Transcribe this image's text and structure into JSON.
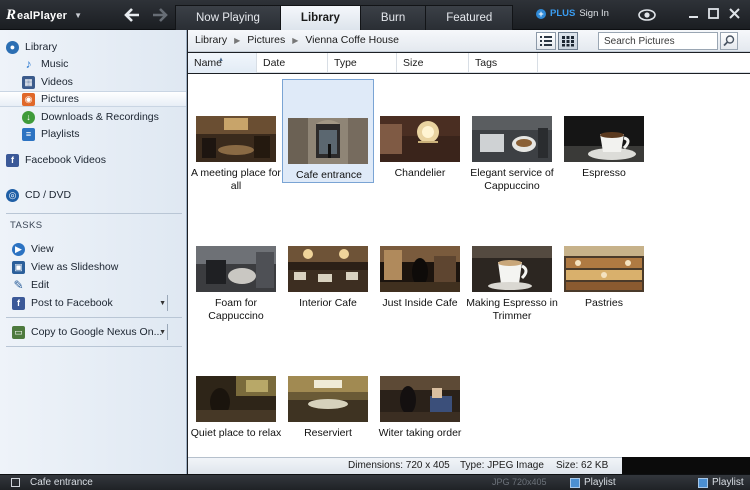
{
  "app": {
    "logo_mark": "R",
    "logo_text": "ealPlayer",
    "tabs": [
      {
        "label": "Now Playing",
        "active": false
      },
      {
        "label": "Library",
        "active": true
      },
      {
        "label": "Burn",
        "active": false
      },
      {
        "label": "Featured",
        "active": false
      }
    ],
    "plus_label": "PLUS",
    "signin_label": "Sign In",
    "icons": {
      "back": "arrow-left-icon",
      "forward": "arrow-right-icon",
      "eye": "eye-icon",
      "minimize": "minimize-icon",
      "maximize": "maximize-icon",
      "close": "close-icon"
    }
  },
  "sidebar": {
    "items": [
      {
        "label": "Library",
        "icon": "library-icon",
        "selected": false
      },
      {
        "label": "Music",
        "icon": "music-note-icon",
        "selected": false
      },
      {
        "label": "Videos",
        "icon": "film-icon",
        "selected": false
      },
      {
        "label": "Pictures",
        "icon": "camera-icon",
        "selected": true
      },
      {
        "label": "Downloads & Recordings",
        "icon": "download-icon",
        "selected": false
      },
      {
        "label": "Playlists",
        "icon": "playlist-icon",
        "selected": false
      },
      {
        "label": "Facebook Videos",
        "icon": "facebook-icon",
        "selected": false
      },
      {
        "label": "CD / DVD",
        "icon": "disc-icon",
        "selected": false
      }
    ],
    "tasks_header": "TASKS",
    "tasks": [
      {
        "label": "View",
        "icon": "play-icon"
      },
      {
        "label": "View as Slideshow",
        "icon": "slideshow-icon"
      },
      {
        "label": "Edit",
        "icon": "pencil-icon"
      },
      {
        "label": "Post to Facebook",
        "icon": "facebook-icon",
        "dropdown": true
      },
      {
        "label": "Copy to Google Nexus On...",
        "icon": "device-icon",
        "dropdown": true
      }
    ]
  },
  "breadcrumb": [
    "Library",
    "Pictures",
    "Vienna Coffe House"
  ],
  "search": {
    "placeholder": "Search Pictures"
  },
  "columns": [
    "Name",
    "Date",
    "Type",
    "Size",
    "Tags"
  ],
  "sorted_column": "Name",
  "pictures": [
    {
      "caption": "A meeting place for all",
      "selected": false
    },
    {
      "caption": "Cafe entrance",
      "selected": true
    },
    {
      "caption": "Chandelier",
      "selected": false
    },
    {
      "caption": "Elegant service of Cappuccino",
      "selected": false
    },
    {
      "caption": "Espresso",
      "selected": false
    },
    {
      "caption": "Foam for Cappuccino",
      "selected": false
    },
    {
      "caption": "Interior Cafe",
      "selected": false
    },
    {
      "caption": "Just Inside Cafe",
      "selected": false
    },
    {
      "caption": "Making Espresso in Trimmer",
      "selected": false
    },
    {
      "caption": "Pastries",
      "selected": false
    },
    {
      "caption": "Quiet place to relax",
      "selected": false
    },
    {
      "caption": "Reserviert",
      "selected": false
    },
    {
      "caption": "Witer taking order",
      "selected": false
    }
  ],
  "status": {
    "dimensions": "Dimensions: 720 x 405",
    "type": "Type: JPEG Image",
    "size": "Size: 62 KB"
  },
  "bottom": {
    "now_playing": "Cafe entrance",
    "format": "JPG  720x405",
    "playlist_label": "Playlist",
    "playlist_label_2": "Playlist"
  },
  "colors": {
    "accent": "#3a9cf0",
    "selection_border": "#7aa4d4",
    "selection_fill": "#dfeaf8"
  }
}
